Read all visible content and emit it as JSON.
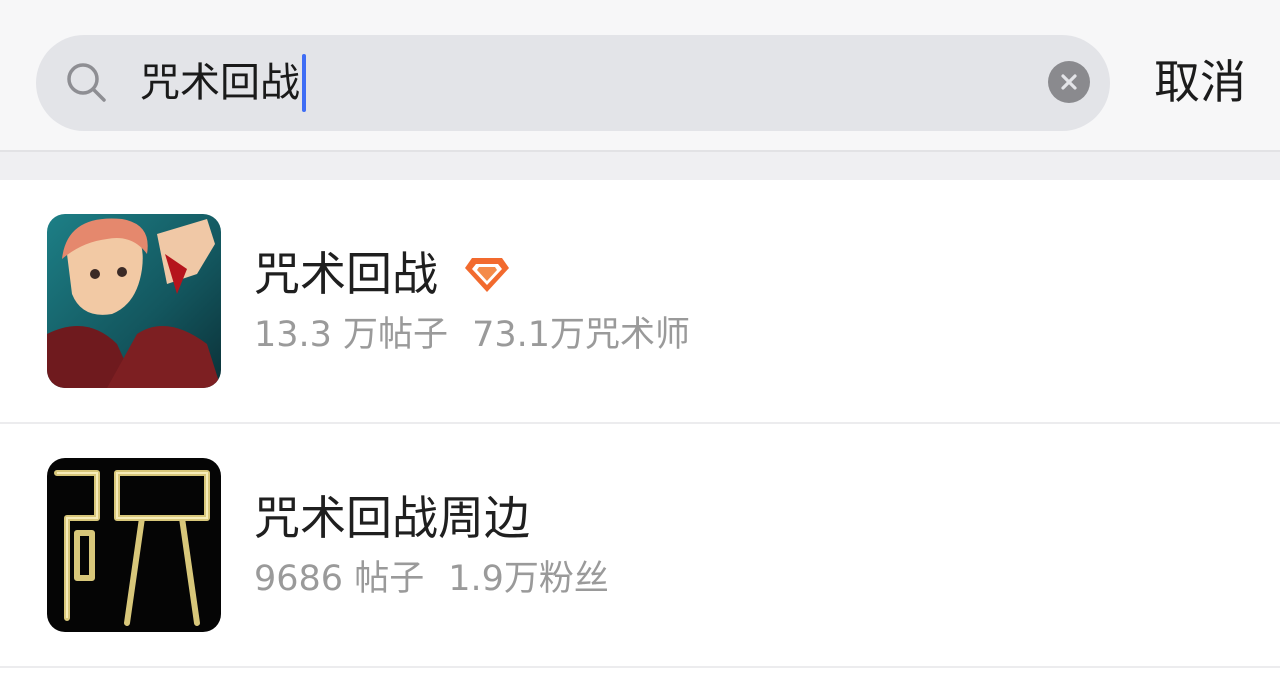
{
  "search": {
    "query": "咒术回战",
    "cancel_label": "取消"
  },
  "results": [
    {
      "title": "咒术回战",
      "posts": "13.3 万帖子",
      "followers": "73.1万咒术师",
      "badge": "diamond-icon",
      "thumb": "anime-character-avatar"
    },
    {
      "title": "咒术回战周边",
      "posts": "9686 帖子",
      "followers": "1.9万粉丝",
      "thumb": "glowing-calligraphy-avatar"
    }
  ],
  "colors": {
    "accent_caret": "#3f6df5",
    "badge_orange": "#f26a2e"
  }
}
